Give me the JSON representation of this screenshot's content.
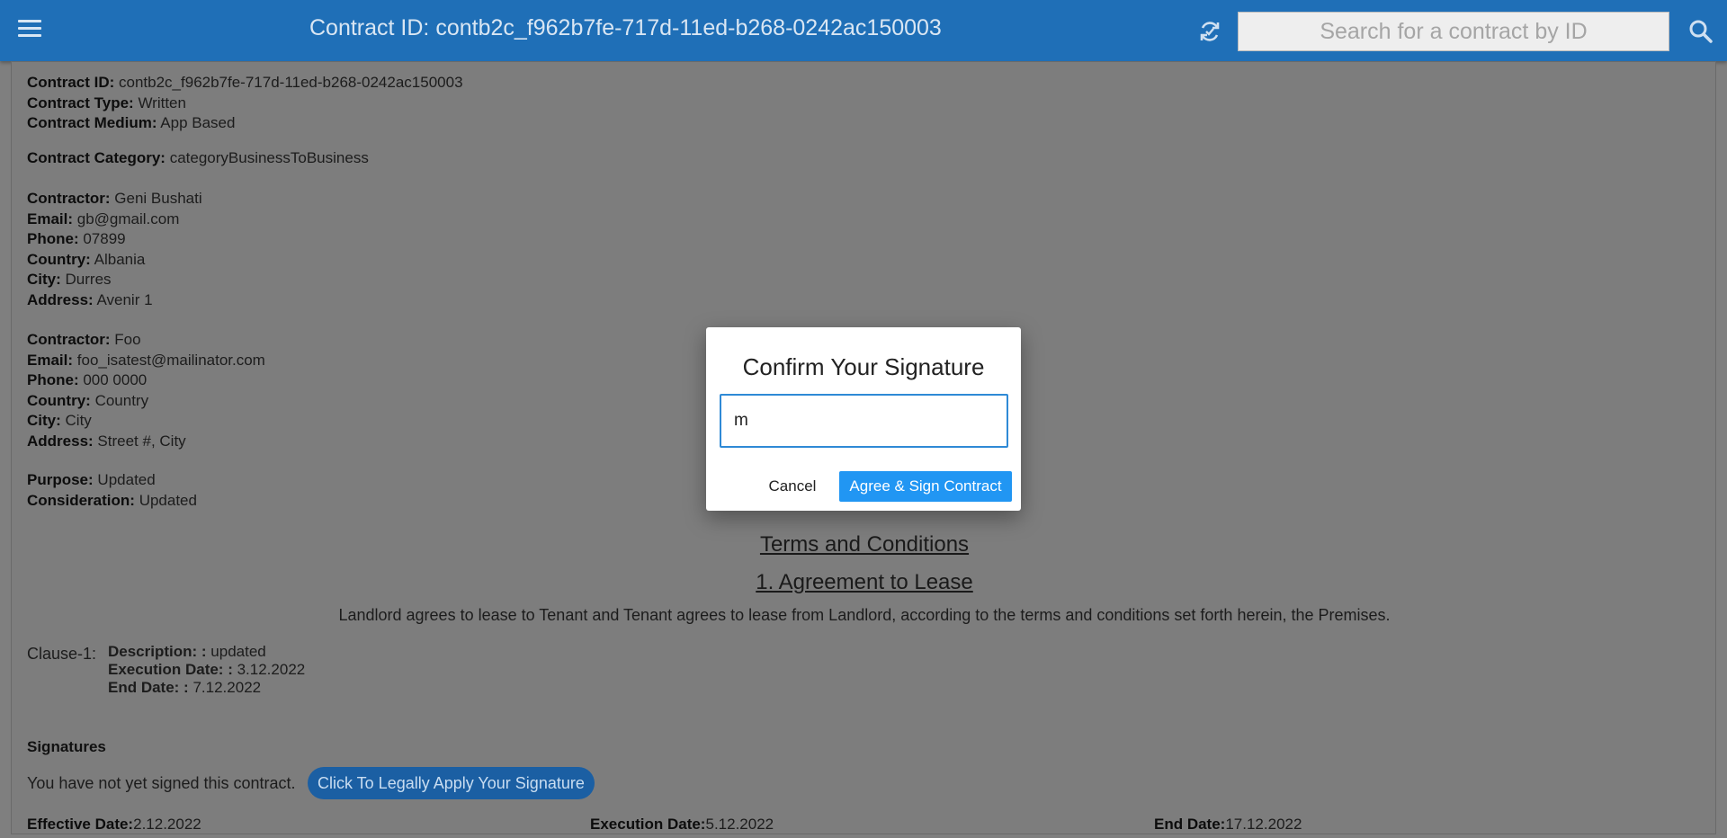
{
  "appbar": {
    "title": "Contract ID: contb2c_f962b7fe-717d-11ed-b268-0242ac150003",
    "search_placeholder": "Search for a contract by ID"
  },
  "contract": {
    "id_label": "Contract ID:",
    "id_value": "contb2c_f962b7fe-717d-11ed-b268-0242ac150003",
    "type_label": "Contract Type:",
    "type_value": "Written",
    "medium_label": "Contract Medium:",
    "medium_value": "App Based",
    "category_label": "Contract Category:",
    "category_value": "categoryBusinessToBusiness"
  },
  "contractor1": {
    "name_label": "Contractor:",
    "name": "Geni Bushati",
    "email_label": "Email:",
    "email": "gb@gmail.com",
    "phone_label": "Phone:",
    "phone": "07899",
    "country_label": "Country:",
    "country": "Albania",
    "city_label": "City:",
    "city": "Durres",
    "address_label": "Address:",
    "address": "Avenir 1"
  },
  "contractor2": {
    "name_label": "Contractor:",
    "name": "Foo",
    "email_label": "Email:",
    "email": "foo_isatest@mailinator.com",
    "phone_label": "Phone:",
    "phone": "000 0000",
    "country_label": "Country:",
    "country": "Country",
    "city_label": "City:",
    "city": "City",
    "address_label": "Address:",
    "address": "Street #, City"
  },
  "details": {
    "purpose_label": "Purpose:",
    "purpose": "Updated",
    "consideration_label": "Consideration:",
    "consideration": "Updated"
  },
  "terms": {
    "heading": "Terms and Conditions",
    "section_heading": "1. Agreement to Lease",
    "text": "Landlord agrees to lease to Tenant and Tenant agrees to lease from Landlord, according to the terms and conditions set forth herein, the Premises."
  },
  "clause": {
    "label": "Clause-1:",
    "description_label": "Description: :",
    "description": "updated",
    "execution_label": "Execution Date: :",
    "execution": "3.12.2022",
    "end_label": "End Date: :",
    "end": "7.12.2022"
  },
  "signatures": {
    "heading": "Signatures",
    "status_text": "You have not yet signed this contract.",
    "apply_button": "Click To Legally Apply Your Signature"
  },
  "dates": {
    "effective_label": "Effective Date:",
    "effective": "2.12.2022",
    "execution_label": "Execution Date:",
    "execution": "5.12.2022",
    "end_label": "End Date:",
    "end": "17.12.2022"
  },
  "modal": {
    "title": "Confirm Your Signature",
    "input_value": "m",
    "cancel_label": "Cancel",
    "agree_label": "Agree & Sign Contract"
  },
  "icons": {
    "menu": "menu-icon",
    "refresh": "sync-icon",
    "search": "search-icon"
  }
}
